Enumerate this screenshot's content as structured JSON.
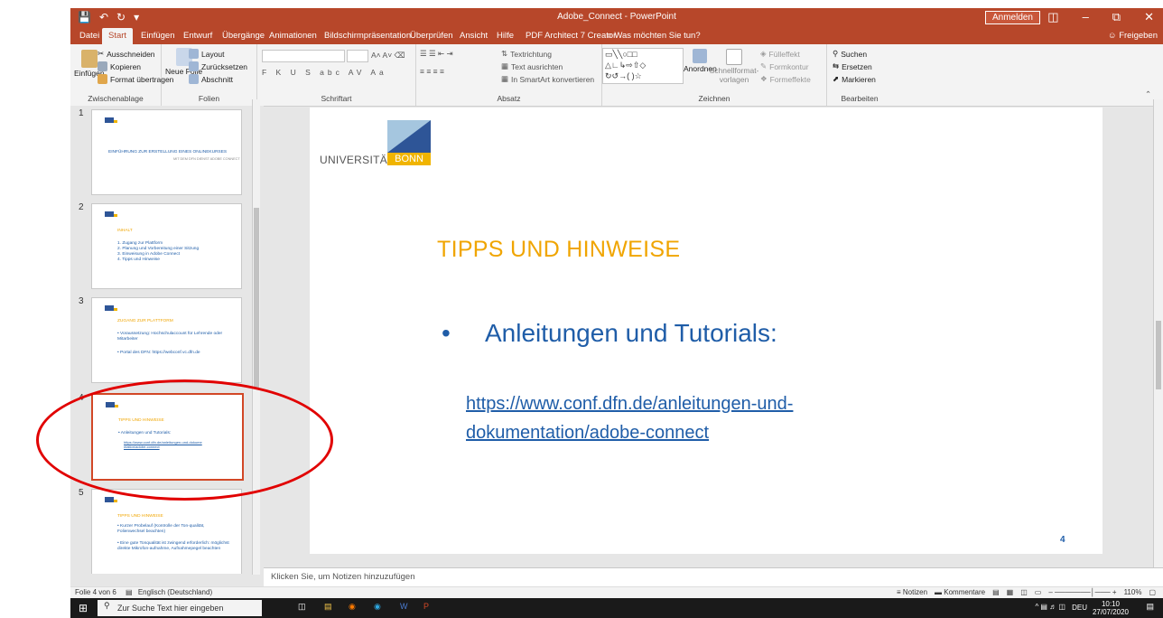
{
  "window": {
    "title": "Adobe_Connect - PowerPoint",
    "signin": "Anmelden"
  },
  "tabs": [
    "Datei",
    "Start",
    "Einfügen",
    "Entwurf",
    "Übergänge",
    "Animationen",
    "Bildschirmpräsentation",
    "Überprüfen",
    "Ansicht",
    "Hilfe",
    "PDF Architect 7 Creator"
  ],
  "tell_me": "Was möchten Sie tun?",
  "share": "Freigeben",
  "ribbon": {
    "clipboard": {
      "paste": "Einfügen",
      "cut": "Ausschneiden",
      "copy": "Kopieren",
      "format_painter": "Format übertragen",
      "label": "Zwischenablage"
    },
    "slides": {
      "new_slide": "Neue Folie",
      "layout": "Layout",
      "reset": "Zurücksetzen",
      "section": "Abschnitt",
      "label": "Folien"
    },
    "font": {
      "label": "Schriftart"
    },
    "paragraph": {
      "text_direction": "Textrichtung",
      "align_text": "Text ausrichten",
      "smartart": "In SmartArt konvertieren",
      "label": "Absatz"
    },
    "drawing": {
      "arrange": "Anordnen",
      "quick_styles": "Schnellformat-vorlagen",
      "fill": "Fülleffekt",
      "outline": "Formkontur",
      "effects": "Formeffekte",
      "label": "Zeichnen"
    },
    "editing": {
      "find": "Suchen",
      "replace": "Ersetzen",
      "select": "Markieren",
      "label": "Bearbeiten"
    }
  },
  "thumbnails": [
    {
      "num": "1",
      "title": "EINFÜHRUNG ZUR ERSTELLUNG EINES ONLINEKURSES",
      "sub": "MIT DEM DFN DIENST ADOBE CONNECT"
    },
    {
      "num": "2",
      "title": "INHALT",
      "items": [
        "1. Zugang zur Plattform",
        "2. Planung und Vorbereitung einer Sitzung",
        "3. Einweisung in Adobe Connect",
        "4. Tipps und Hinweise"
      ]
    },
    {
      "num": "3",
      "title": "ZUGANG ZUR PLATTFORM",
      "items": [
        "•  Voraussetzung: Hochschulaccount für Lehrende oder Mitarbeiter",
        "•  Portal des DFN: https://webconf.vc.dfn.de"
      ]
    },
    {
      "num": "4",
      "title": "TIPPS UND HINWEISE",
      "items": [
        "•  Anleitungen und Tutorials:"
      ],
      "link": "https://www.conf.dfn.de/anleitungen-und-dokumentation/adobe-connect"
    },
    {
      "num": "5",
      "title": "TIPPS UND HINWEISE",
      "items": [
        "•  Kurzer Probelauf (Kontrolle der Ton-qualität, Folienwechsel beachten)",
        "•  Eine gute Tonqualität ist zwingend erforderlich: möglichst direkte Mikrofon-aufnahme, Aufnahmepegel beachten"
      ]
    }
  ],
  "slide": {
    "university_word": "UNIVERSITÄT",
    "bonn_word": "BONN",
    "title": "TIPPS UND HINWEISE",
    "bullet": "Anleitungen und Tutorials:",
    "link_line1": "https://www.conf.dfn.de/anleitungen-und-",
    "link_line2": "dokumentation/adobe-connect",
    "number": "4"
  },
  "notes_placeholder": "Klicken Sie, um Notizen hinzuzufügen",
  "status": {
    "slide": "Folie 4 von 6",
    "language": "Englisch (Deutschland)",
    "notes": "Notizen",
    "comments": "Kommentare",
    "zoom": "110%"
  },
  "taskbar": {
    "search_placeholder": "Zur Suche Text hier eingeben",
    "lang": "DEU",
    "time": "10:10",
    "date": "27/07/2020"
  },
  "colors": {
    "accent": "#b7472a",
    "title_orange": "#f0a500",
    "text_blue": "#1f5da8",
    "annotation": "#e10000"
  }
}
